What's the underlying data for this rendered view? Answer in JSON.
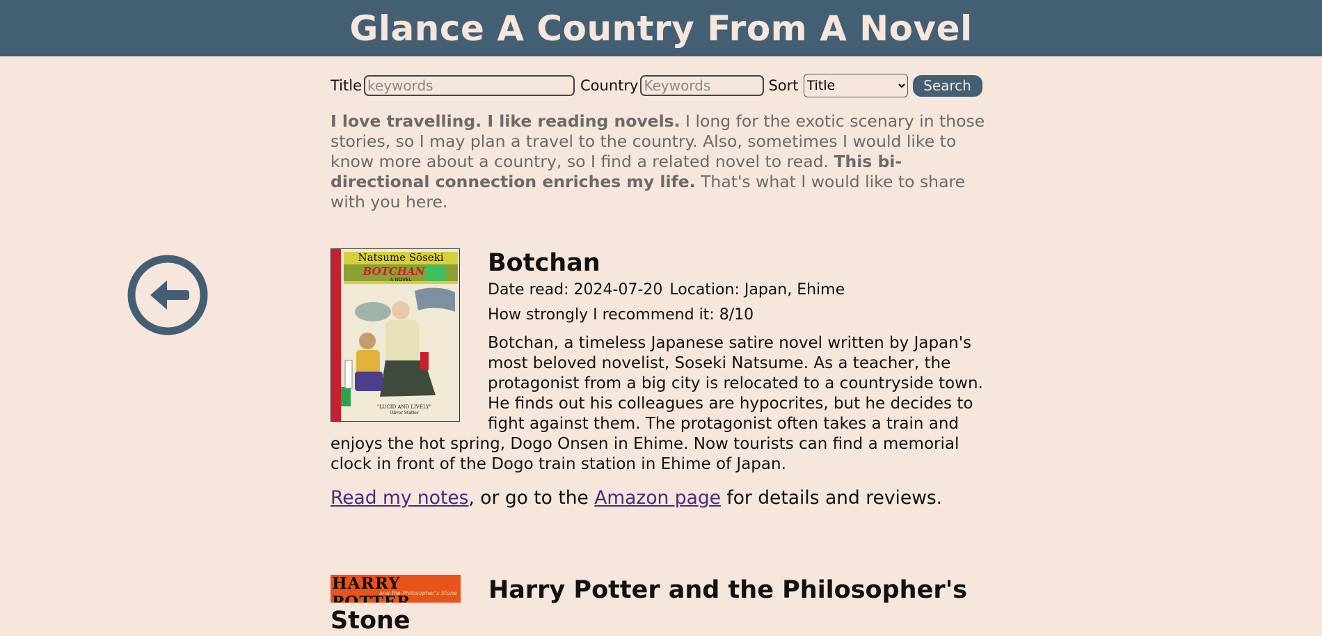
{
  "header": {
    "title": "Glance A Country From A Novel"
  },
  "back_button": {
    "icon": "arrow-left-circle-icon"
  },
  "search": {
    "title_label": "Title",
    "title_placeholder": "keywords",
    "title_value": "",
    "country_label": "Country",
    "country_placeholder": "Keywords",
    "country_value": "",
    "sort_label": "Sort",
    "sort_selected": "Title",
    "button_label": "Search"
  },
  "intro": {
    "bold1": "I love travelling. I like reading novels.",
    "text1": " I long for the exotic scenary in those stories, so I may plan a travel to the country. Also, sometimes I would like to know more about a country, so I find a related novel to read. ",
    "bold2": "This bi-directional connection enriches my life.",
    "text2": " That's what I would like to share with you here."
  },
  "books": [
    {
      "title": "Botchan",
      "date_read": "Date read: 2024-07-20",
      "location": "Location: Japan, Ehime",
      "recommend": "How strongly I recommend it: 8/10",
      "description": "Botchan, a timeless Japanese satire novel written by Japan's most beloved novelist, Soseki Natsume. As a teacher, the protagonist from a big city is relocated to a countryside town. He finds out his colleagues are hypocrites, but he decides to fight against them. The protagonist often takes a train and enjoys the hot spring, Dogo Onsen in Ehime. Now tourists can find a memorial clock in front of the Dogo train station in Ehime of Japan.",
      "notes_link": "Read my notes",
      "middle_text": ", or go to the ",
      "amazon_link": "Amazon page",
      "tail_text": " for details and reviews.",
      "cover": {
        "author": "Natsume Sōseki",
        "title": "BOTCHAN",
        "subtitle": "A NOVEL",
        "quote": "\"LUCID AND LIVELY\"",
        "quote_by": "Oliver Statler"
      }
    },
    {
      "title": "Harry Potter and the Philosopher's Stone",
      "cover": {
        "title": "HARRY POTTER",
        "subtitle": "and the Philosopher's Stone"
      }
    }
  ],
  "colors": {
    "background": "#f7e6dc",
    "header": "#425f73",
    "header_text": "#f7e6dc",
    "intro_text": "#6a6a6a",
    "link": "#4a2a80"
  }
}
